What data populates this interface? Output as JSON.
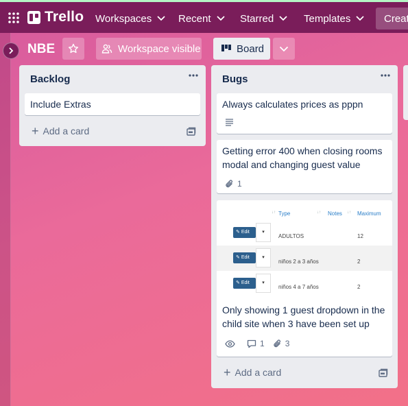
{
  "topbar": {
    "brand": "Trello",
    "nav": [
      "Workspaces",
      "Recent",
      "Starred",
      "Templates"
    ],
    "create_label": "Create"
  },
  "board": {
    "title": "NBE",
    "visibility_label": "Workspace visible",
    "view_label": "Board"
  },
  "lists": [
    {
      "title": "Backlog",
      "cards": [
        {
          "title": "Include Extras"
        }
      ],
      "add_card_label": "Add a card"
    },
    {
      "title": "Bugs",
      "cards": [
        {
          "title": "Always calculates prices as pppn",
          "badges": {
            "description": true
          }
        },
        {
          "title": "Getting error 400 when closing rooms modal and changing guest value",
          "badges": {
            "attachments": "1"
          }
        },
        {
          "title": "Only showing 1 guest dropdown in the child site when 3 have been set up",
          "badges": {
            "watching": true,
            "comments": "1",
            "attachments": "3"
          },
          "cover": {
            "headers": [
              "Type",
              "Notes",
              "Maximum"
            ],
            "edit_label": "Edit",
            "rows": [
              {
                "type": "ADULTOS",
                "max": "12"
              },
              {
                "type": "niños 2 a 3 años",
                "max": "2"
              },
              {
                "type": "niños 4 a 7 años",
                "max": "2"
              }
            ]
          }
        }
      ],
      "add_card_label": "Add a card"
    }
  ],
  "colors": {
    "topbar": "#7a1d5a",
    "list_bg": "#ebecf0",
    "card_text": "#172b4d",
    "muted_text": "#5e6c84",
    "edit_button": "#2c5f8d"
  },
  "icons": [
    "apps-icon",
    "chevron-down-icon",
    "star-icon",
    "people-icon",
    "board-icon",
    "chevron-right-icon",
    "more-icon",
    "plus-icon",
    "template-icon",
    "description-icon",
    "attachment-icon",
    "eye-icon",
    "comment-icon"
  ]
}
